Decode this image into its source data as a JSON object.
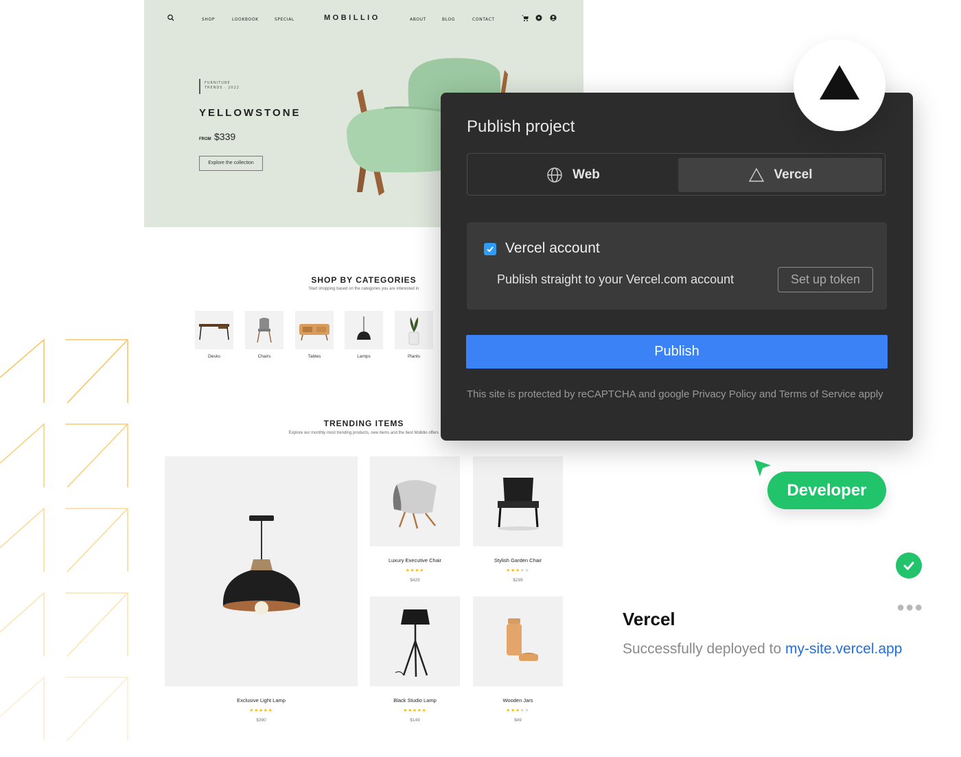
{
  "site": {
    "nav": {
      "left_items": [
        "SHOP",
        "LOOKBOOK",
        "SPECIAL"
      ],
      "logo": "MOBILLIO",
      "right_items": [
        "ABOUT",
        "BLOG",
        "CONTACT"
      ]
    },
    "hero": {
      "tag_line1": "FURNITURE",
      "tag_line2": "TRENDS · 2022",
      "title": "YELLOWSTONE",
      "from_label": "FROM",
      "price": "$339",
      "cta": "Explore the collection"
    },
    "categories": {
      "title": "SHOP BY CATEGORIES",
      "subtitle": "Start shopping based on the categories you are interested in",
      "items": [
        "Desks",
        "Chairs",
        "Tables",
        "Lamps",
        "Plants"
      ]
    },
    "trending": {
      "title": "TRENDING ITEMS",
      "subtitle": "Explore our monthly most trending products, new items and the best Mobilio offers",
      "products": [
        {
          "name": "Exclusive Light Lamp",
          "rating": 5,
          "price": "$390"
        },
        {
          "name": "Luxury Executive Chair",
          "rating": 4,
          "price": "$429"
        },
        {
          "name": "Stylish Garden Chair",
          "rating": 3,
          "price": "$299"
        },
        {
          "name": "Black Studio Lamp",
          "rating": 5,
          "price": "$149"
        },
        {
          "name": "Wooden Jars",
          "rating": 3,
          "price": "$49"
        }
      ]
    }
  },
  "dialog": {
    "title": "Publish project",
    "tabs": {
      "web": "Web",
      "vercel": "Vercel"
    },
    "selected_tab": "Vercel",
    "account": {
      "checked": true,
      "title": "Vercel account",
      "description": "Publish straight to your Vercel.com account",
      "token_button": "Set up token"
    },
    "publish_button": "Publish",
    "legal": "This site is protected by reCAPTCHA and google Privacy Policy and Terms of Service apply",
    "accent_color": "#3b82f6"
  },
  "developer_badge": {
    "label": "Developer",
    "color": "#21c36b"
  },
  "deploy": {
    "title": "Vercel",
    "message": "Successfully deployed to ",
    "link": "my-site.vercel.app"
  }
}
